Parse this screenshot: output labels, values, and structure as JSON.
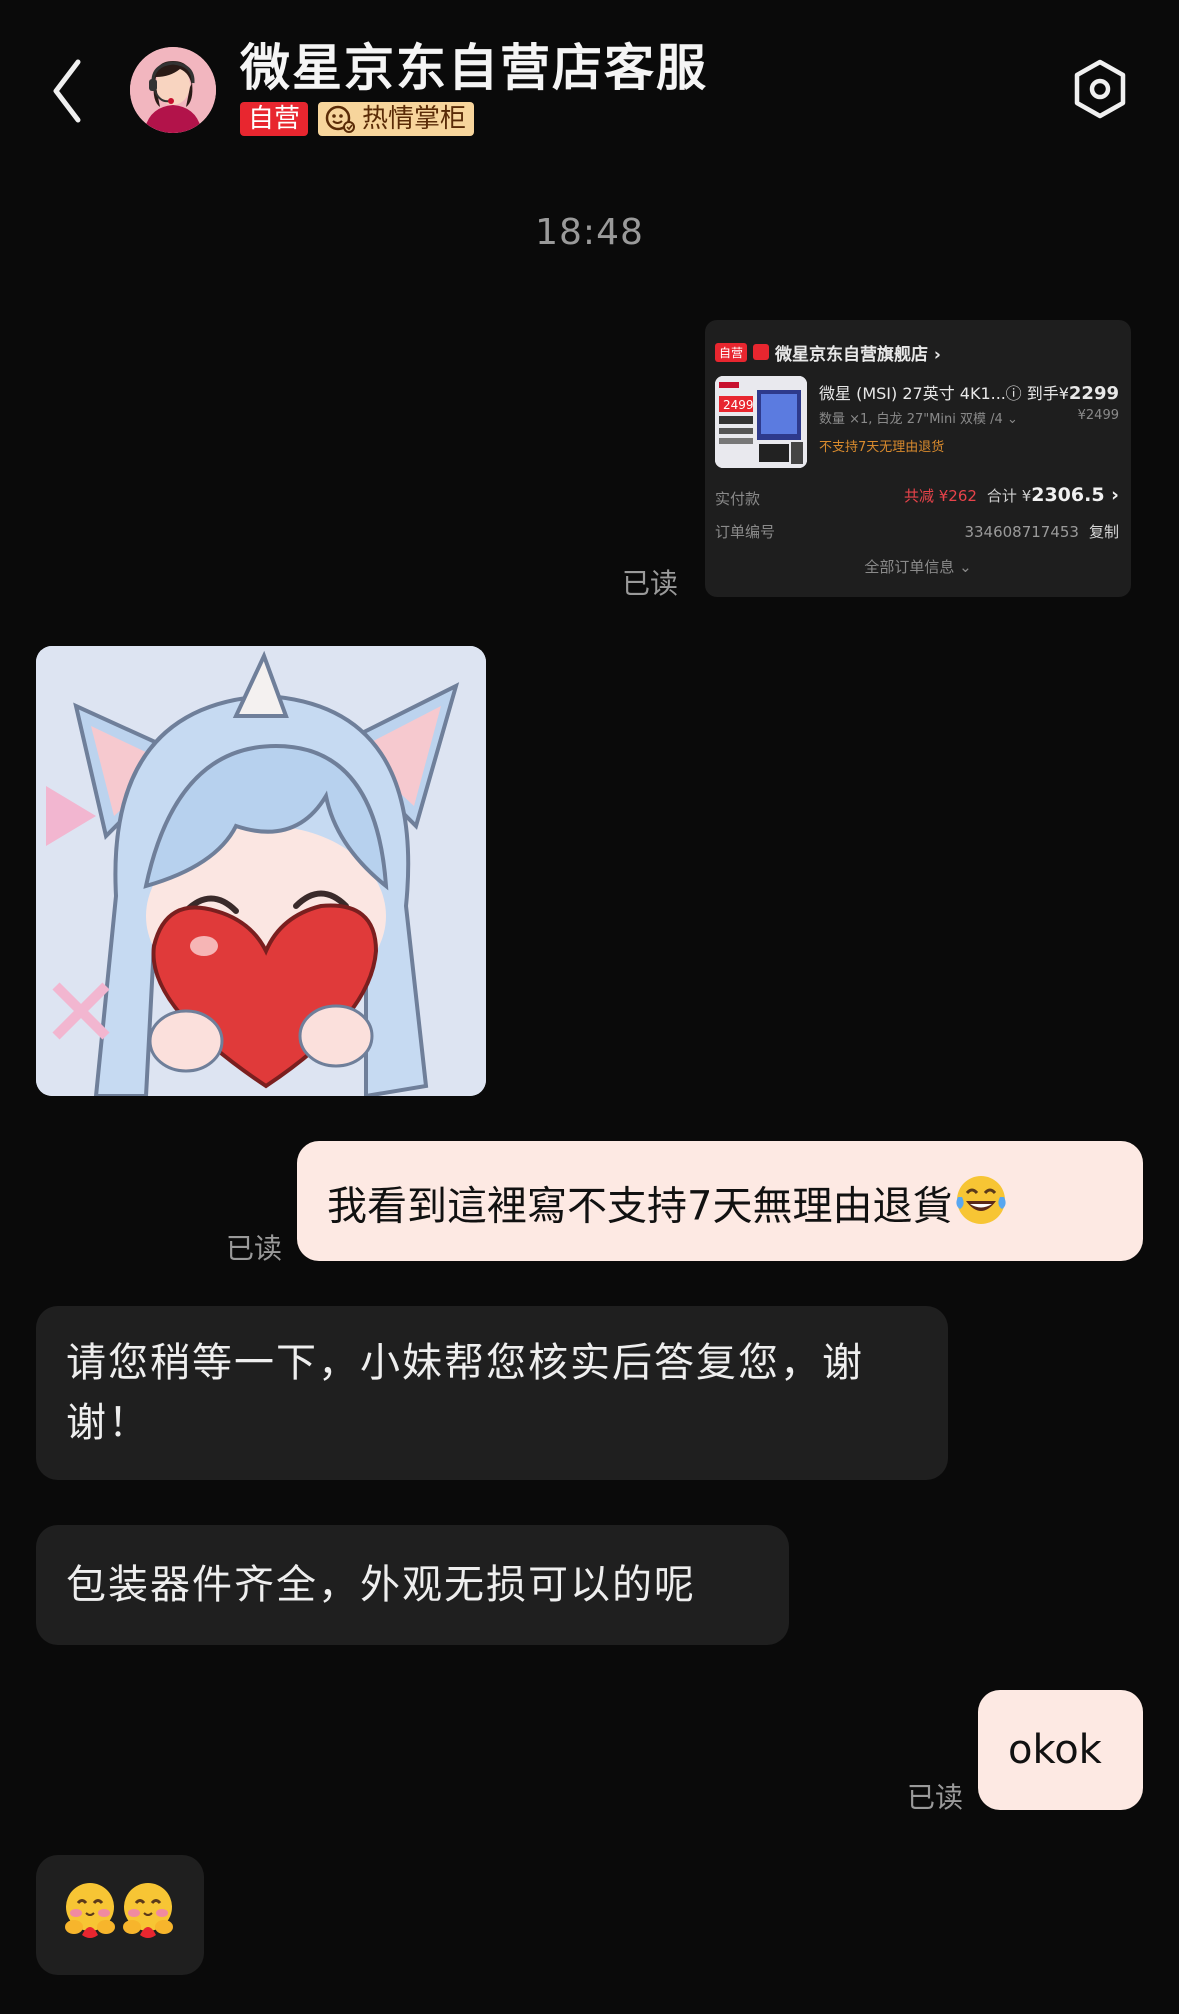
{
  "header": {
    "title": "微星京东自营店客服",
    "badge_self": "自营",
    "badge_warm": "热情掌柜"
  },
  "timestamp": "18:48",
  "order_card": {
    "self_tag": "自营",
    "store_name": "微星京东自营旗舰店 ›",
    "product_name": "微星 (MSI) 27英寸 4K1...",
    "price_prefix": "ⓘ 到手¥",
    "price": "2299",
    "spec": "数量 ×1, 白龙 27\"Mini 双模 /4 ⌄",
    "original_price": "¥2499",
    "warning": "不支持7天无理由退货",
    "paid_label": "实付款",
    "discount": "共减 ¥262",
    "total_prefix": "合计 ¥",
    "total": "2306.5 ›",
    "order_no_label": "订单编号",
    "order_no": "334608717453",
    "copy_label": "复制",
    "all_info": "全部订单信息 ⌄",
    "thumb_price": "2499"
  },
  "read_label": "已读",
  "messages": [
    {
      "side": "me",
      "text": "我看到這裡寫不支持7天無理由退貨"
    },
    {
      "side": "them",
      "text": "请您稍等一下，小妹帮您核实后答复您，谢谢！"
    },
    {
      "side": "them",
      "text": "包装器件齐全，外观无损可以的呢"
    },
    {
      "side": "me",
      "text": "okok"
    }
  ],
  "colors": {
    "background": "#0a0a0a",
    "my_bubble": "#fde9e3",
    "their_bubble": "#1f1f1f",
    "badge_red": "#e8262f",
    "badge_gold": "#f7d59c"
  }
}
